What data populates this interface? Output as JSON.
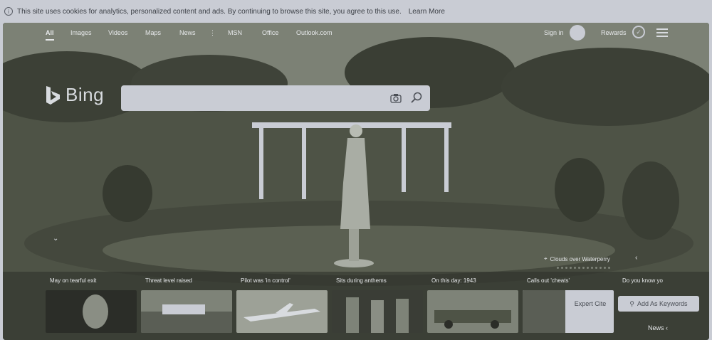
{
  "cookie": {
    "text": "This site uses cookies for analytics, personalized content and ads. By continuing to browse this site, you agree to this use.",
    "learn_more": "Learn More"
  },
  "nav": {
    "items": [
      "All",
      "Images",
      "Videos",
      "Maps",
      "News",
      "MSN",
      "Office",
      "Outlook.com"
    ],
    "more": "⋮",
    "signin": "Sign in",
    "rewards": "Rewards"
  },
  "logo": {
    "text": "Bing"
  },
  "search": {
    "value": "",
    "placeholder": ""
  },
  "image_caption": "Clouds over Waterperry",
  "cards": [
    {
      "title": "May on tearful exit"
    },
    {
      "title": "Threat level raised"
    },
    {
      "title": "Pilot was 'in control'"
    },
    {
      "title": "Sits during anthems"
    },
    {
      "title": "On this day: 1943"
    },
    {
      "title": "Calls out 'cheats'"
    },
    {
      "title": "Do you know yo"
    }
  ],
  "buttons": {
    "expert_cite": "Expert Cite",
    "add_keywords": "Add As Keywords"
  },
  "news_link": "News ‹",
  "colors": {
    "bar": "#c9ccd4",
    "hero": "#4e5346",
    "text_light": "#e6e8ea"
  }
}
